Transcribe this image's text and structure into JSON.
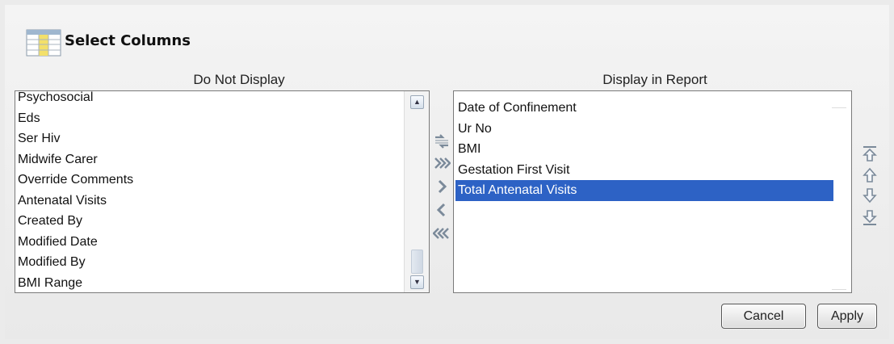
{
  "dialog": {
    "title": "Select Columns",
    "icon": "table-columns-icon"
  },
  "available": {
    "header": "Do Not Display",
    "items": [
      "Psychosocial",
      "Eds",
      "Ser Hiv",
      "Midwife Carer",
      "Override Comments",
      "Antenatal Visits",
      "Created By",
      "Modified Date",
      "Modified By",
      "BMI Range"
    ]
  },
  "selected": {
    "header": "Display in Report",
    "items": [
      "Date of Confinement",
      "Ur No",
      "BMI",
      "Gestation First Visit",
      "Total Antenatal Visits"
    ],
    "selected_index": 4,
    "selection_color": "#2d62c5"
  },
  "transfer_buttons": [
    {
      "name": "swap-all-icon"
    },
    {
      "name": "move-all-right-icon"
    },
    {
      "name": "move-right-icon"
    },
    {
      "name": "move-left-icon"
    },
    {
      "name": "move-all-left-icon"
    }
  ],
  "order_buttons": [
    {
      "name": "move-top-icon"
    },
    {
      "name": "move-up-icon"
    },
    {
      "name": "move-down-icon"
    },
    {
      "name": "move-bottom-icon"
    }
  ],
  "actions": {
    "cancel_label": "Cancel",
    "apply_label": "Apply"
  },
  "colors": {
    "arrow": "#7b8a9a",
    "accent": "#2d62c5"
  }
}
